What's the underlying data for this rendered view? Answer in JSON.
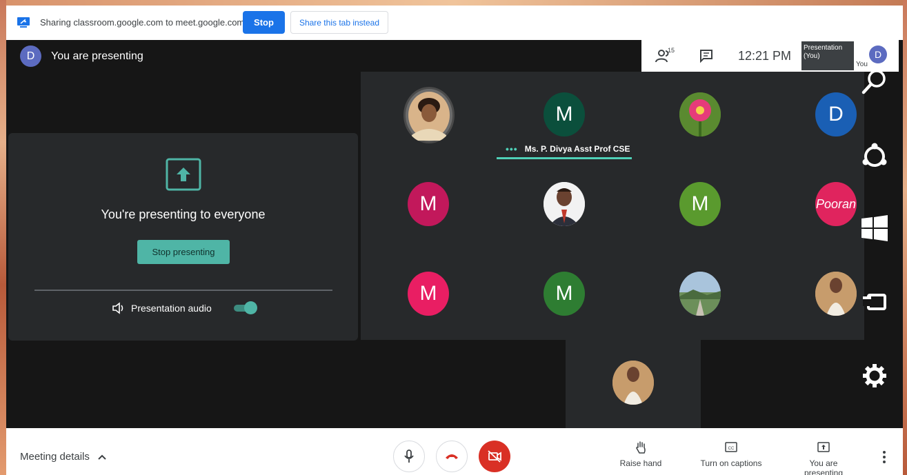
{
  "share_bar": {
    "text": "Sharing classroom.google.com to meet.google.com",
    "stop_label": "Stop",
    "share_tab_label": "Share this tab instead"
  },
  "header": {
    "avatar_letter": "D",
    "title": "You are presenting"
  },
  "top_right": {
    "people_count": "15",
    "time": "12:21 PM",
    "thumb_label": "Presentation (You)",
    "you_label": "You",
    "avatar_letter": "D"
  },
  "present_panel": {
    "message": "You're presenting to everyone",
    "stop_button": "Stop presenting",
    "audio_label": "Presentation audio",
    "audio_on": true
  },
  "participants": [
    {
      "kind": "photo",
      "name": "participant-photo-1"
    },
    {
      "kind": "letter",
      "letter": "M",
      "color": "#0b4f3c"
    },
    {
      "kind": "photo",
      "name": "participant-flower"
    },
    {
      "kind": "letter",
      "letter": "D",
      "color": "#1a5fb4"
    },
    {
      "kind": "letter",
      "letter": "M",
      "color": "#c2185b"
    },
    {
      "kind": "photo",
      "name": "participant-photo-2"
    },
    {
      "kind": "letter",
      "letter": "M",
      "color": "#5a9a2e"
    },
    {
      "kind": "text",
      "text": "Pooran",
      "color": "#e0245e"
    },
    {
      "kind": "letter",
      "letter": "M",
      "color": "#e91e63"
    },
    {
      "kind": "letter",
      "letter": "M",
      "color": "#2e7d32"
    },
    {
      "kind": "photo",
      "name": "participant-landscape"
    },
    {
      "kind": "photo",
      "name": "participant-photo-3"
    }
  ],
  "speaker_name": "Ms. P. Divya Asst Prof CSE",
  "bottom_bar": {
    "meeting_details": "Meeting details",
    "raise_hand": "Raise hand",
    "captions": "Turn on captions",
    "presenting": "You are presenting"
  },
  "colors": {
    "accent_teal": "#4fb5a6",
    "meet_blue": "#1a73e8",
    "hangup_red": "#d93025"
  }
}
